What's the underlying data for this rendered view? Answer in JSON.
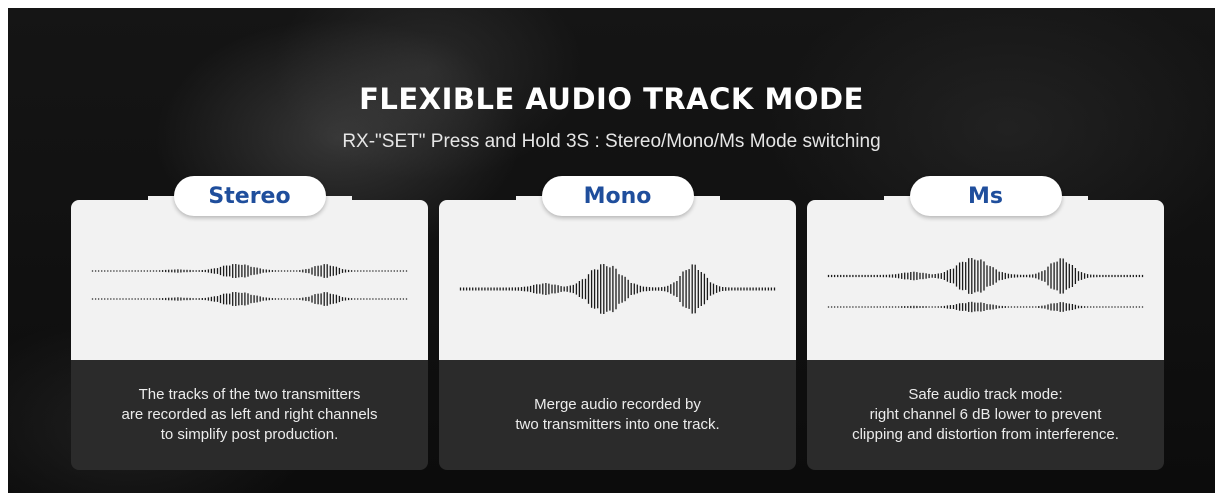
{
  "header": {
    "title": "FLEXIBLE AUDIO TRACK MODE",
    "subtitle": "RX-\"SET\" Press and Hold 3S : Stereo/Mono/Ms Mode switching"
  },
  "colors": {
    "accent_blue": "#1f4e9c",
    "card_light": "#f2f2f2",
    "card_dark": "#2b2b2b",
    "background": "#111111"
  },
  "modes": [
    {
      "label": "Stereo",
      "tracks": 2,
      "right_channel_level": 1.0,
      "description": "The tracks of the two transmitters\nare recorded as left and right channels\nto simplify post production."
    },
    {
      "label": "Mono",
      "tracks": 1,
      "right_channel_level": 1.0,
      "description": "Merge audio recorded by\ntwo transmitters into one track."
    },
    {
      "label": "Ms",
      "tracks": 2,
      "right_channel_level": 0.5,
      "description": "Safe audio track mode:\nright channel 6 dB lower to prevent\nclipping and distortion from interference."
    }
  ]
}
